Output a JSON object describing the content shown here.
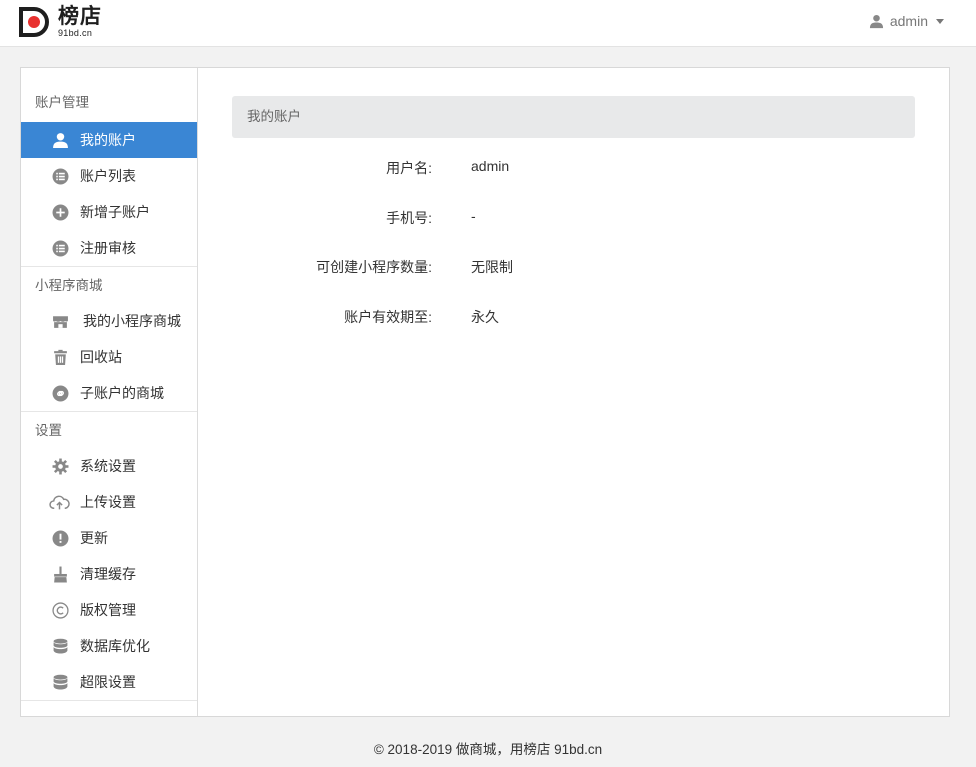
{
  "brand": {
    "logo_letter": "D",
    "title": "榜店",
    "subtitle": "91bd.cn",
    "accent": "#e8312f"
  },
  "topbar": {
    "user_icon": "person-icon",
    "username": "admin",
    "dropdown_icon": "caret-down-icon"
  },
  "sidebar": {
    "active_color": "#3a86d4",
    "groups": [
      {
        "title": "账户管理",
        "items": [
          {
            "label": "我的账户",
            "icon": "user-icon",
            "active": true
          },
          {
            "label": "账户列表",
            "icon": "list-icon"
          },
          {
            "label": "新增子账户",
            "icon": "plus-circle-icon"
          },
          {
            "label": "注册审核",
            "icon": "list-icon"
          }
        ]
      },
      {
        "title": "小程序商城",
        "items": [
          {
            "label": "我的小程序商城",
            "icon": "store-icon"
          },
          {
            "label": "回收站",
            "icon": "trash-icon"
          },
          {
            "label": "子账户的商城",
            "icon": "link-icon"
          }
        ]
      },
      {
        "title": "设置",
        "items": [
          {
            "label": "系统设置",
            "icon": "gear-icon"
          },
          {
            "label": "上传设置",
            "icon": "cloud-upload-icon"
          },
          {
            "label": "更新",
            "icon": "alert-circle-icon"
          },
          {
            "label": "清理缓存",
            "icon": "broom-icon"
          },
          {
            "label": "版权管理",
            "icon": "copyright-icon"
          },
          {
            "label": "数据库优化",
            "icon": "database-icon"
          },
          {
            "label": "超限设置",
            "icon": "database-icon"
          }
        ]
      }
    ]
  },
  "main": {
    "panel_title": "我的账户",
    "fields": [
      {
        "label": "用户名:",
        "value": "admin"
      },
      {
        "label": "手机号:",
        "value": "-"
      },
      {
        "label": "可创建小程序数量:",
        "value": "无限制"
      },
      {
        "label": "账户有效期至:",
        "value": "永久"
      }
    ]
  },
  "footer": {
    "text": "© 2018-2019 做商城，用榜店 91bd.cn"
  }
}
